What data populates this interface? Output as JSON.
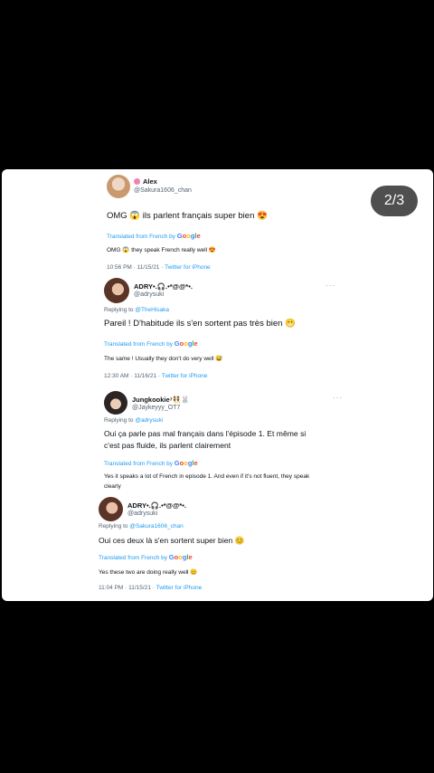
{
  "counter": "2/3",
  "translated_label": "Translated from French by",
  "google": [
    "G",
    "o",
    "o",
    "g",
    "l",
    "e"
  ],
  "tweets": [
    {
      "name": "Alex",
      "handle": "@Sakura1606_chan",
      "text": "OMG 😱 ils parlent français super bien 😍",
      "translation": "OMG 😱 they speak French really well 😍",
      "timestamp": "10:56 PM · 11/15/21 ·",
      "source": "Twitter for iPhone"
    },
    {
      "name": "ADRY•.🎧.•*@@*•.",
      "handle": "@adrysuki",
      "replying_label": "Replying to",
      "replying_to": "@TheHisaka",
      "text": "Pareil ! D'habitude ils s'en sortent pas très bien 😬",
      "translation": "The same ! Usually they don't do very well 😅",
      "timestamp": "12:30 AM · 11/16/21 ·",
      "source": "Twitter for iPhone"
    },
    {
      "name": "Jungkookie⁷👯🐰",
      "handle": "@Jaykeyyy_OT7",
      "replying_label": "Replying to",
      "replying_to": "@adrysuki",
      "text_line1": "Oui ça parle pas mal français dans l'épisode 1. Et même si",
      "text_line2": "c'est pas fluide, ils parlent clairement",
      "translation_line1": "Yes it speaks a lot of French in episode 1. And even if it's not fluent, they speak",
      "translation_line2": "clearly"
    },
    {
      "name": "ADRY•.🎧.•*@@*•.",
      "handle": "@adrysuki",
      "replying_label": "Replying to",
      "replying_to": "@Sakura1606_chan",
      "text": "Oui ces deux là s'en sortent super bien 😊",
      "translation": "Yes these two are doing really well 😊",
      "timestamp": "11:04 PM · 11/15/21 ·",
      "source": "Twitter for iPhone"
    }
  ]
}
